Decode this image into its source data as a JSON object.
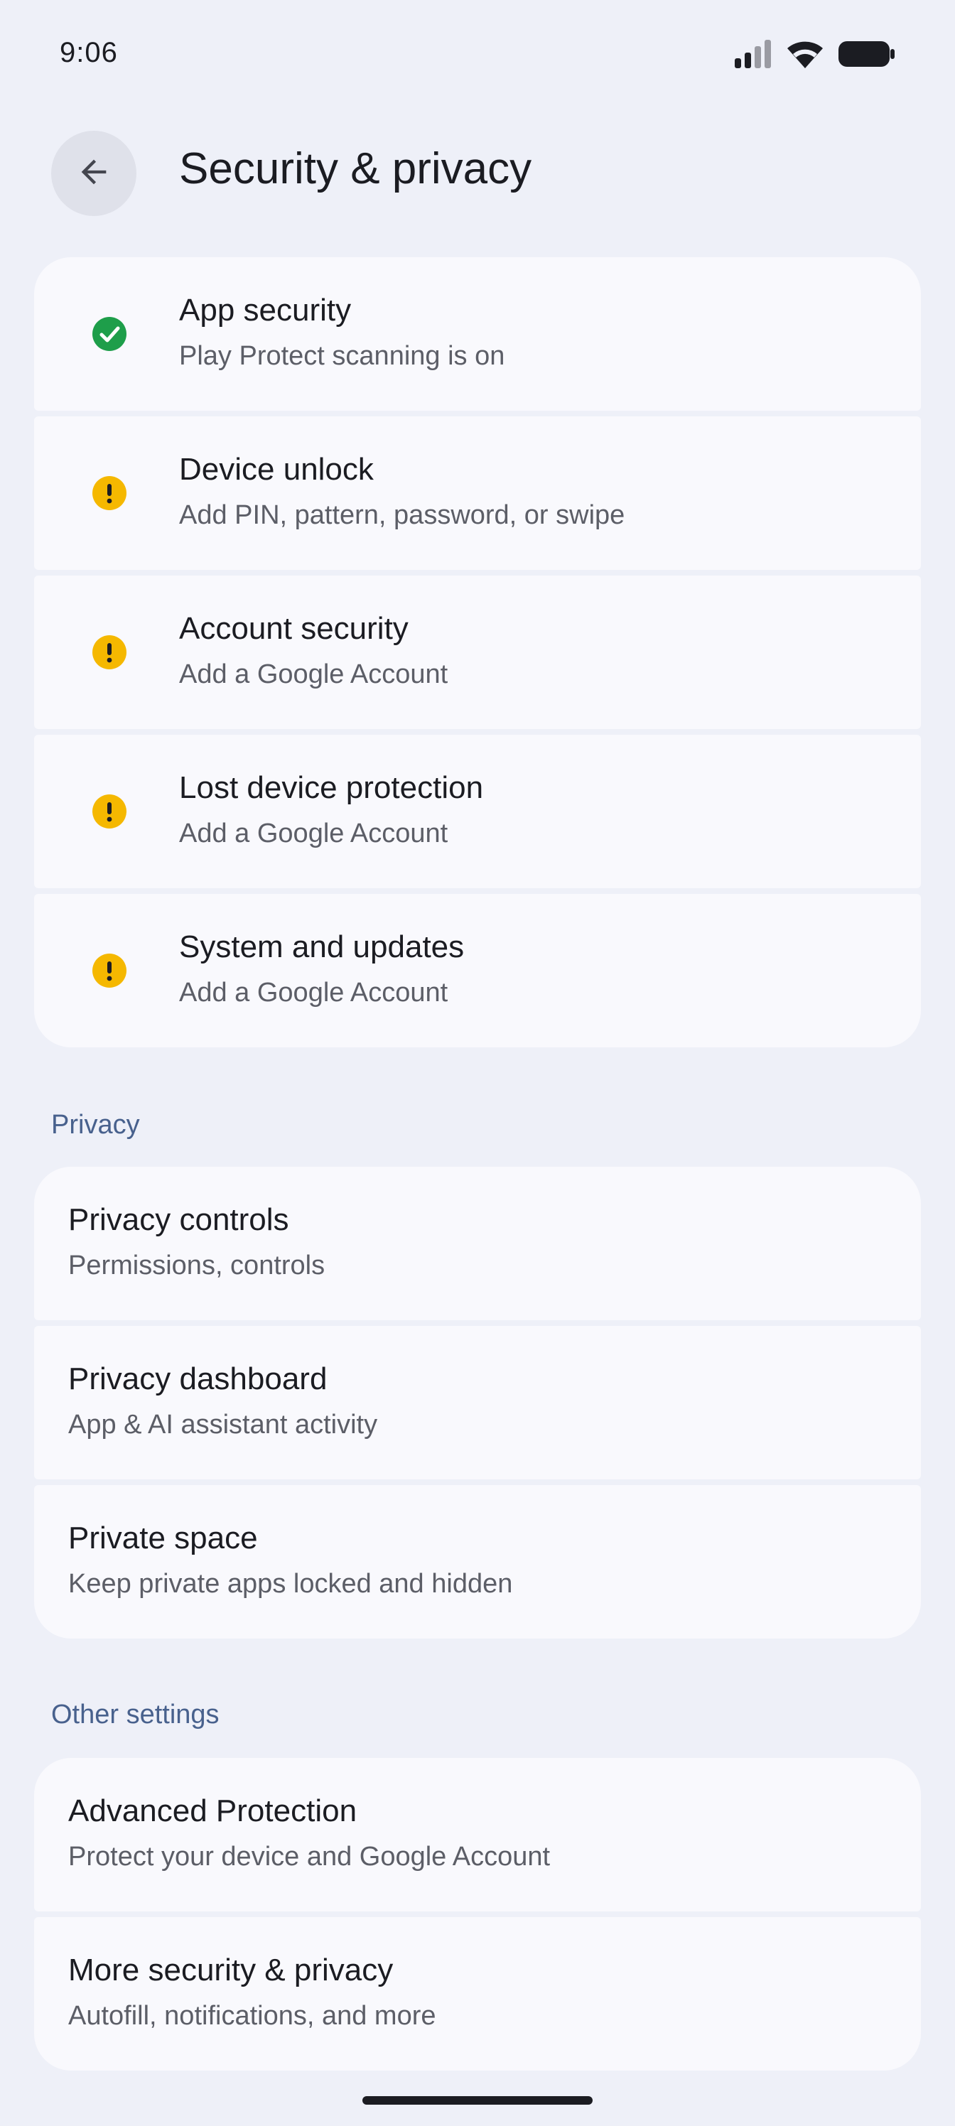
{
  "status_bar": {
    "time": "9:06",
    "icons": [
      "signal-icon",
      "wifi-icon",
      "battery-icon"
    ]
  },
  "app_bar": {
    "back_icon": "arrow-back-icon",
    "title": "Security & privacy"
  },
  "status_items": [
    {
      "title": "App security",
      "subtitle": "Play Protect scanning is on",
      "status": "ok",
      "icon": "check-circle-icon"
    },
    {
      "title": "Device unlock",
      "subtitle": "Add PIN, pattern, password, or swipe",
      "status": "warning",
      "icon": "warning-circle-icon"
    },
    {
      "title": "Account security",
      "subtitle": "Add a Google Account",
      "status": "warning",
      "icon": "warning-circle-icon"
    },
    {
      "title": "Lost device protection",
      "subtitle": "Add a Google Account",
      "status": "warning",
      "icon": "warning-circle-icon"
    },
    {
      "title": "System and updates",
      "subtitle": "Add a Google Account",
      "status": "warning",
      "icon": "warning-circle-icon"
    }
  ],
  "privacy": {
    "header": "Privacy",
    "items": [
      {
        "title": "Privacy controls",
        "subtitle": "Permissions, controls"
      },
      {
        "title": "Privacy dashboard",
        "subtitle": "App & AI assistant activity"
      },
      {
        "title": "Private space",
        "subtitle": "Keep private apps locked and hidden"
      }
    ]
  },
  "other": {
    "header": "Other settings",
    "items": [
      {
        "title": "Advanced Protection",
        "subtitle": "Protect your device and Google Account"
      },
      {
        "title": "More security & privacy",
        "subtitle": "Autofill, notifications, and more"
      }
    ]
  },
  "colors": {
    "background": "#eef0f8",
    "card": "#f9f9fd",
    "ok_green": "#1e9e4a",
    "warning_yellow": "#f5b800",
    "section_header": "#48618d"
  }
}
